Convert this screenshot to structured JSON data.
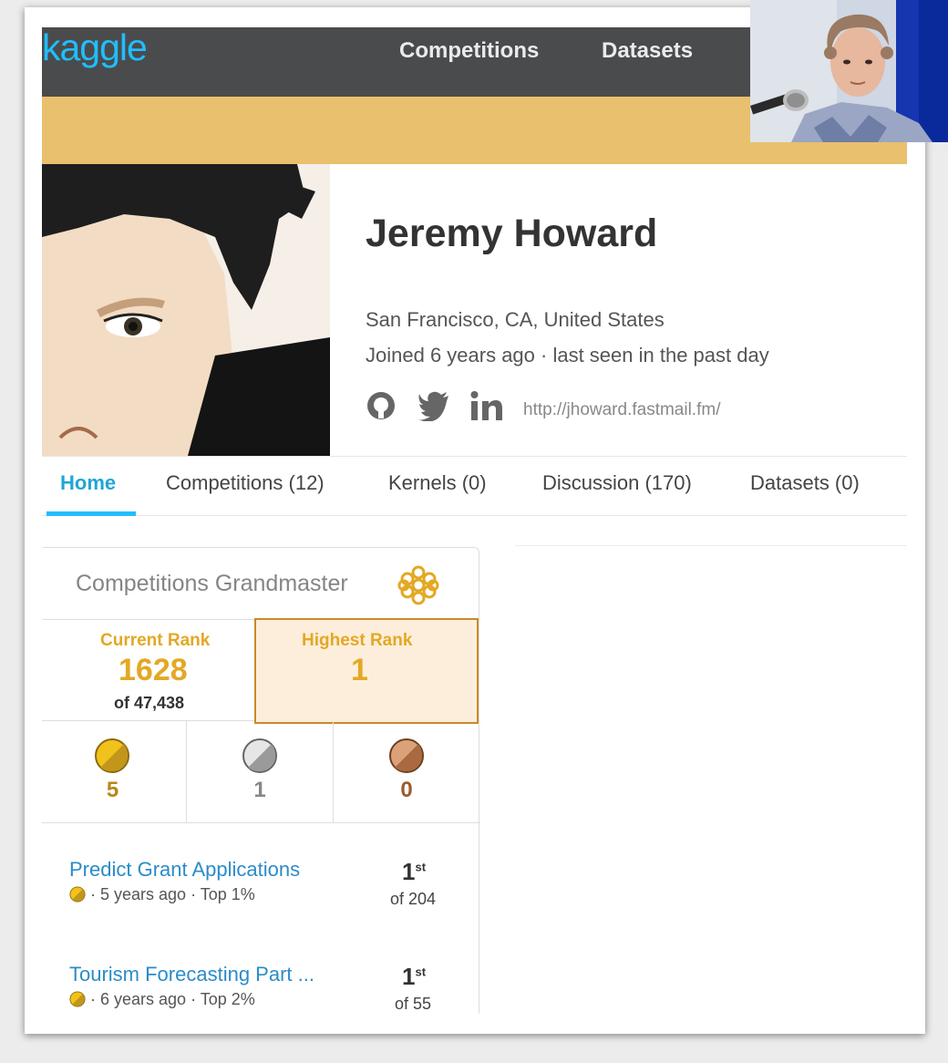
{
  "nav": {
    "logo": "kaggle",
    "links": [
      "Competitions",
      "Datasets"
    ]
  },
  "profile": {
    "name": "Jeremy Howard",
    "location": "San Francisco, CA, United States",
    "joined": "Joined 6 years ago · last seen in the past day",
    "website": "http://jhoward.fastmail.fm/",
    "social_icons": [
      "github-icon",
      "twitter-icon",
      "linkedin-icon"
    ]
  },
  "tabs": [
    {
      "label": "Home",
      "active": true
    },
    {
      "label": "Competitions (12)"
    },
    {
      "label": "Kernels (0)"
    },
    {
      "label": "Discussion (170)"
    },
    {
      "label": "Datasets (0)"
    }
  ],
  "card": {
    "tier": "Competitions Grandmaster",
    "current_rank_label": "Current Rank",
    "current_rank": "1628",
    "current_rank_of": "of 47,438",
    "highest_rank_label": "Highest Rank",
    "highest_rank": "1",
    "medals": {
      "gold": "5",
      "silver": "1",
      "bronze": "0"
    },
    "competitions": [
      {
        "title": "Predict Grant Applications",
        "meta": "· 5 years ago · Top 1%",
        "place": "1",
        "suffix": "st",
        "of": "of 204"
      },
      {
        "title": "Tourism Forecasting Part ...",
        "meta": "· 6 years ago · Top 2%",
        "place": "1",
        "suffix": "st",
        "of": "of 55"
      }
    ]
  },
  "colors": {
    "nav_bg": "#4a4b4d",
    "banner": "#e9c06d",
    "accent": "#20beff",
    "gold": "#e3a824",
    "silver": "#9a9a9a",
    "bronze": "#b5713f",
    "link": "#2b8cc9"
  }
}
